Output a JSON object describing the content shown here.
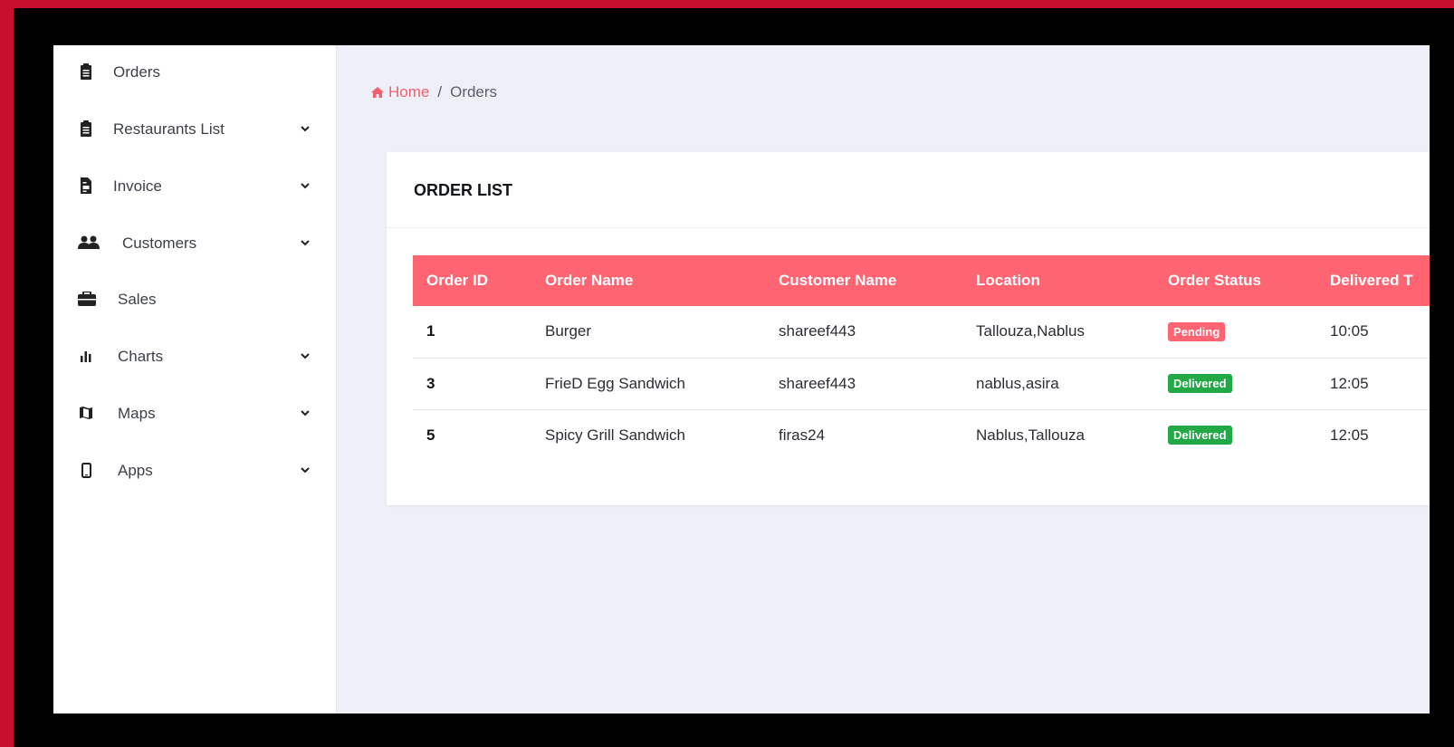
{
  "theme": {
    "outer_border": "#c8102e",
    "frame": "#000000",
    "accent": "#ff6473",
    "pending": "#ff6473",
    "delivered": "#22a846"
  },
  "sidebar": {
    "items": [
      {
        "label": "Orders",
        "icon": "clipboard-icon",
        "has_chevron": false
      },
      {
        "label": "Restaurants List",
        "icon": "clipboard-icon",
        "has_chevron": true
      },
      {
        "label": "Invoice",
        "icon": "file-invoice-icon",
        "has_chevron": true
      },
      {
        "label": "Customers",
        "icon": "users-icon",
        "has_chevron": true
      },
      {
        "label": "Sales",
        "icon": "briefcase-icon",
        "has_chevron": false
      },
      {
        "label": "Charts",
        "icon": "bar-chart-icon",
        "has_chevron": true
      },
      {
        "label": "Maps",
        "icon": "map-icon",
        "has_chevron": true
      },
      {
        "label": "Apps",
        "icon": "mobile-icon",
        "has_chevron": true
      }
    ]
  },
  "breadcrumb": {
    "home": "Home",
    "separator": "/",
    "current": "Orders"
  },
  "card": {
    "title": "ORDER LIST"
  },
  "table": {
    "columns": [
      "Order ID",
      "Order Name",
      "Customer Name",
      "Location",
      "Order Status",
      "Delivered T"
    ],
    "rows": [
      {
        "id": "1",
        "name": "Burger",
        "customer": "shareef443",
        "location": "Tallouza,Nablus",
        "status": "Pending",
        "time": "10:05"
      },
      {
        "id": "3",
        "name": "FrieD Egg Sandwich",
        "customer": "shareef443",
        "location": "nablus,asira",
        "status": "Delivered",
        "time": "12:05"
      },
      {
        "id": "5",
        "name": "Spicy Grill Sandwich",
        "customer": "firas24",
        "location": "Nablus,Tallouza",
        "status": "Delivered",
        "time": "12:05"
      }
    ]
  }
}
